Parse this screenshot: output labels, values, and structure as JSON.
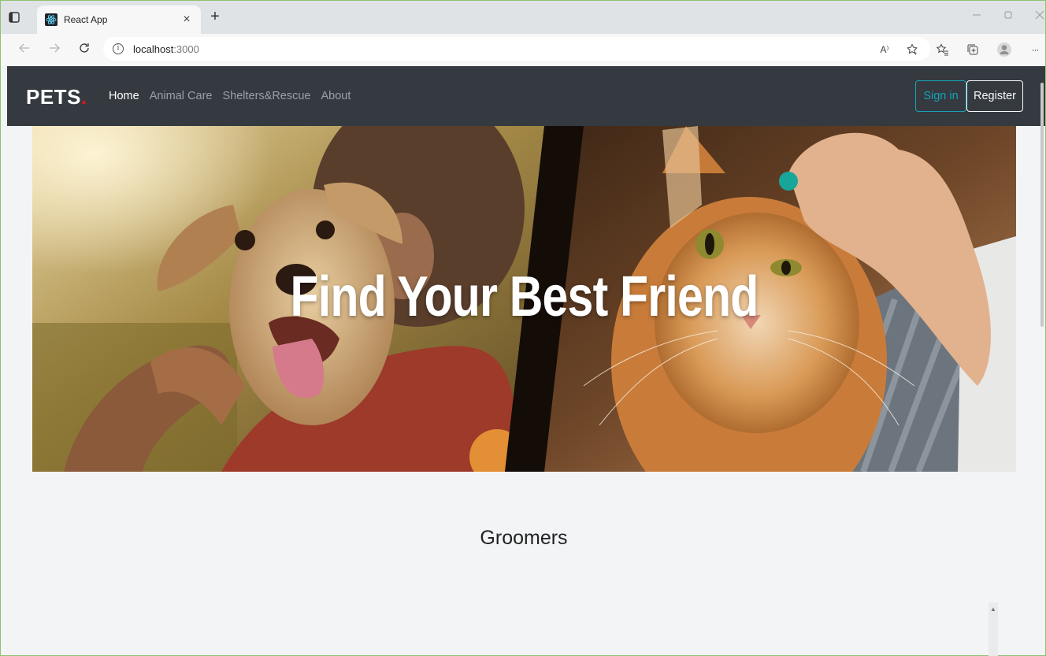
{
  "browser": {
    "tab_title": "React App",
    "tab_close": "×",
    "new_tab": "+",
    "url": "localhost:3000",
    "url_host": "localhost",
    "url_port": ":3000",
    "icons": {
      "sidebar": "sidebar-toggle-icon",
      "favicon": "react-logo-icon",
      "back": "back-arrow-icon",
      "forward": "forward-arrow-icon",
      "refresh": "refresh-icon",
      "info": "info-icon",
      "read_aloud": "read-aloud-icon",
      "add_favorite": "add-favorite-icon",
      "favorites": "favorites-icon",
      "collections": "collections-icon",
      "profile": "profile-icon",
      "more": "more-icon",
      "minimize": "minimize-icon",
      "maximize": "maximize-icon",
      "close": "close-window-icon"
    },
    "read_aloud_glyph": "A⁾",
    "more_glyph": "···"
  },
  "navbar": {
    "brand": "PETS",
    "brand_dot": ".",
    "links": [
      {
        "label": "Home",
        "active": true
      },
      {
        "label": "Animal Care",
        "active": false
      },
      {
        "label": "Shelters&Rescue",
        "active": false
      },
      {
        "label": "About",
        "active": false
      }
    ],
    "signin_label": "Sign in",
    "register_label": "Register",
    "colors": {
      "bg": "#343a40",
      "brand_dot": "#e0161c",
      "signin": "#17a2b8"
    }
  },
  "hero": {
    "title": "Find Your Best Friend",
    "image": "dog and cat being held by owners"
  },
  "content": {
    "section_title": "Groomers"
  }
}
